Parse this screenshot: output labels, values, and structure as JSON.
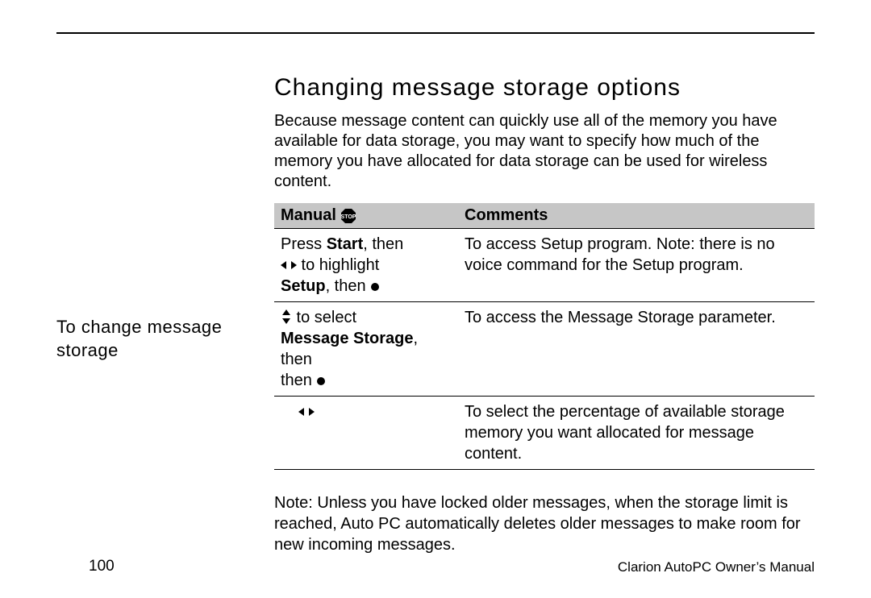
{
  "heading": "Changing message storage options",
  "intro": "Because message content can quickly use all of the memory you have available for data storage, you may want to specify how much of the memory you have allocated for data storage can be used for wireless content.",
  "side_caption_line1": "To change message",
  "side_caption_line2": "storage",
  "table": {
    "header_manual": "Manual",
    "header_comments": "Comments",
    "rows": [
      {
        "manual_pre": "Press ",
        "manual_bold1": "Start",
        "manual_mid1": ", then ",
        "manual_icon1": "lr",
        "manual_mid2": " to highlight ",
        "manual_bold2": "Setup",
        "manual_mid3": ", then ",
        "manual_icon2": "dot",
        "comment": "To access Setup program. Note: there is no voice command for the Setup program."
      },
      {
        "manual_icon1": "ud",
        "manual_mid1": " to select ",
        "manual_bold1": "Message Storage",
        "manual_mid2": ", then ",
        "manual_icon2": "dot",
        "comment": "To access the Message Storage parameter."
      },
      {
        "manual_icon1": "lr",
        "comment": "To select the percentage of available storage memory you want allocated for message content."
      }
    ]
  },
  "note": "Note: Unless you have locked older messages, when the storage limit is reached, Auto PC automatically deletes older messages to make room for new incoming messages.",
  "footer_source": "Clarion AutoPC Owner’s Manual",
  "page_number": "100"
}
